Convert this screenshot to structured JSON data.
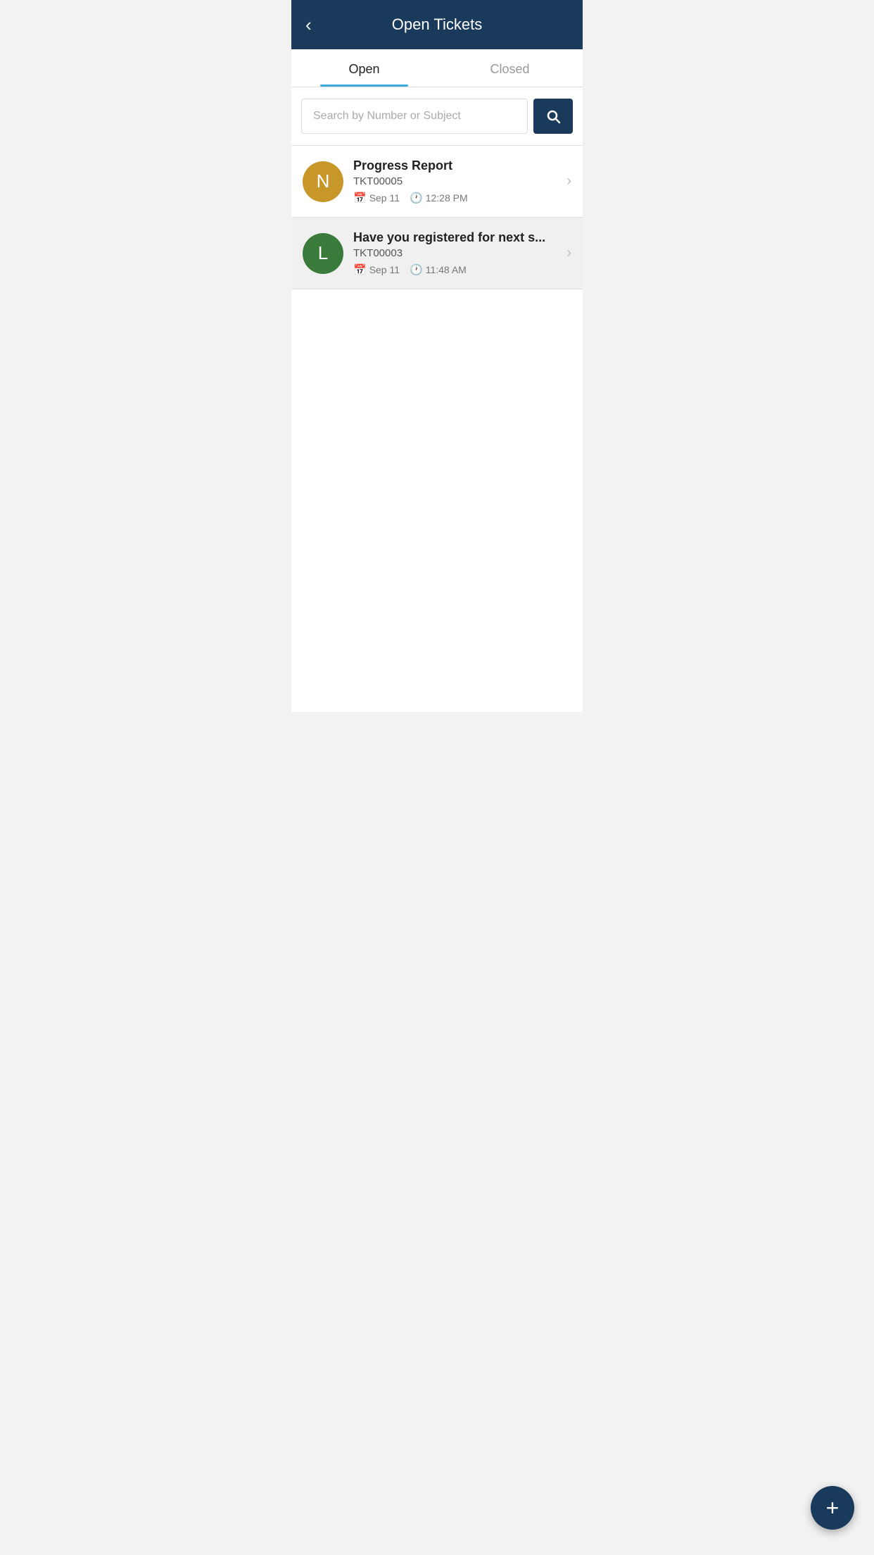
{
  "header": {
    "title": "Open Tickets",
    "back_label": "‹"
  },
  "tabs": [
    {
      "id": "open",
      "label": "Open",
      "active": true
    },
    {
      "id": "closed",
      "label": "Closed",
      "active": false
    }
  ],
  "search": {
    "placeholder": "Search by Number or Subject",
    "value": ""
  },
  "tickets": [
    {
      "id": 1,
      "avatar_letter": "N",
      "avatar_class": "avatar-n",
      "subject": "Progress Report",
      "number": "TKT00005",
      "date": "Sep 11",
      "time": "12:28 PM"
    },
    {
      "id": 2,
      "avatar_letter": "L",
      "avatar_class": "avatar-l",
      "subject": "Have you registered for next s...",
      "number": "TKT00003",
      "date": "Sep 11",
      "time": "11:48 AM"
    }
  ],
  "fab": {
    "label": "+"
  }
}
